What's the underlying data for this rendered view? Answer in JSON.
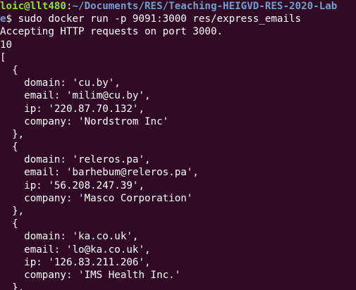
{
  "terminal": {
    "prompt": {
      "user_host": "loic@llt480",
      "separator": ":",
      "path_line1": "~/Documents/RES/Teaching-HEIGVD-RES-2020-Lab",
      "path_line2": "e",
      "symbol": "$ ",
      "command": "sudo docker run -p 9091:3000 res/express_emails"
    },
    "output": [
      "Accepting HTTP requests on port 3000.",
      "10",
      "[",
      "  {",
      "    domain: 'cu.by',",
      "    email: 'milim@cu.by',",
      "    ip: '220.87.70.132',",
      "    company: 'Nordstrom Inc'",
      "  },",
      "  {",
      "    domain: 'releros.pa',",
      "    email: 'barhebum@releros.pa',",
      "    ip: '56.208.247.39',",
      "    company: 'Masco Corporation'",
      "  },",
      "  {",
      "    domain: 'ka.co.uk',",
      "    email: 'lo@ka.co.uk',",
      "    ip: '126.83.211.206',",
      "    company: 'IMS Health Inc.'",
      "  },"
    ]
  },
  "colors": {
    "background": "#300a24",
    "user_host": "#8ae234",
    "path": "#729fcf",
    "text": "#ffffff"
  }
}
